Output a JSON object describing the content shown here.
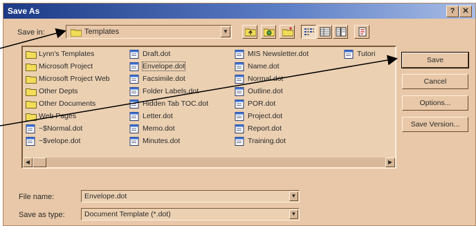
{
  "window": {
    "title": "Save As",
    "help_glyph": "?",
    "close_glyph": "✕"
  },
  "toolbar": {
    "save_in_label": "Save in:",
    "save_in_value": "Templates",
    "buttons": [
      "up-one-level-icon",
      "search-web-icon",
      "create-new-folder-icon",
      "list-view-icon",
      "details-view-icon",
      "properties-view-icon",
      "tools-icon"
    ]
  },
  "files": {
    "col1": [
      {
        "name": "Lynn's Templates",
        "type": "folder"
      },
      {
        "name": "Microsoft Project",
        "type": "folder"
      },
      {
        "name": "Microsoft Project Web",
        "type": "folder"
      },
      {
        "name": "Other Depts",
        "type": "folder"
      },
      {
        "name": "Other Documents",
        "type": "folder"
      },
      {
        "name": "Web Pages",
        "type": "folder"
      },
      {
        "name": "~$Normal.dot",
        "type": "template"
      },
      {
        "name": "~$velope.dot",
        "type": "template"
      }
    ],
    "col2": [
      {
        "name": "Draft.dot",
        "type": "template"
      },
      {
        "name": "Envelope.dot",
        "type": "template"
      },
      {
        "name": "Facsimile.dot",
        "type": "template"
      },
      {
        "name": "Folder Labels.dot",
        "type": "template"
      },
      {
        "name": "Hidden Tab TOC.dot",
        "type": "template"
      },
      {
        "name": "Letter.dot",
        "type": "template"
      },
      {
        "name": "Memo.dot",
        "type": "template"
      },
      {
        "name": "Minutes.dot",
        "type": "template"
      }
    ],
    "col3": [
      {
        "name": "MIS Newsletter.dot",
        "type": "template"
      },
      {
        "name": "Name.dot",
        "type": "template"
      },
      {
        "name": "Normal.dot",
        "type": "template"
      },
      {
        "name": "Outline.dot",
        "type": "template"
      },
      {
        "name": "POR.dot",
        "type": "template"
      },
      {
        "name": "Project.dot",
        "type": "template"
      },
      {
        "name": "Report.dot",
        "type": "template"
      },
      {
        "name": "Training.dot",
        "type": "template"
      }
    ],
    "col4": [
      {
        "name": "Tutori",
        "type": "template"
      }
    ]
  },
  "buttons": {
    "save": "Save",
    "cancel": "Cancel",
    "options": "Options...",
    "save_version": "Save Version..."
  },
  "form": {
    "file_name_label": "File name:",
    "file_name_value": "Envelope.dot",
    "save_as_type_label": "Save as type:",
    "save_as_type_value": "Document Template (*.dot)"
  },
  "colors": {
    "dialog_bg": "#e8c8a8",
    "titlebar_start": "#1c3a86",
    "titlebar_end": "#a9bde6",
    "folder_yellow": "#f2dc58",
    "template_blue": "#3a6ed0"
  }
}
